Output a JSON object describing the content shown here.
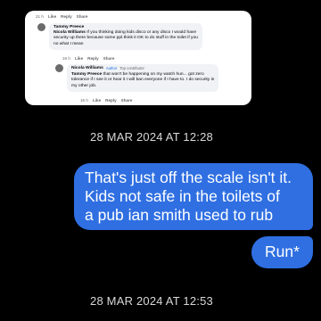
{
  "shared_image": {
    "top_actions": {
      "time": "21 h",
      "like": "Like",
      "reply": "Reply",
      "share": "Share"
    },
    "comment_1": {
      "author": "Tammy Preece",
      "mention": "Nicola Williams",
      "text_1": " If you thinking doing kids disco or any disco I would have",
      "text_2": "security up there because some ppl.think it OK to do stuff in the toilet if you",
      "text_3": "no what I mean"
    },
    "comment_1_actions": {
      "time": "16 h",
      "like": "Like",
      "reply": "Reply",
      "share": "Share"
    },
    "comment_2": {
      "author": "Nicola Williams",
      "badge_author": "Author",
      "badge_role": "Top contributor",
      "mention": "Tammy Preece",
      "text_1": " that won't be happening on my watch hun... got zero",
      "text_2": "tolerance if I see it or hear it I will ban everyone if I have to. I do security in",
      "text_3": "my other job."
    },
    "comment_2_actions": {
      "time": "16 h",
      "like": "Like",
      "reply": "Reply",
      "share": "Share"
    }
  },
  "timestamps": {
    "first": "28 MAR 2024 AT 12:28",
    "second": "28 MAR 2024 AT 12:53"
  },
  "messages": {
    "message_1": {
      "line_1": "That's just off the scale isn't it.",
      "line_2": "Kids not safe in the toilets of",
      "line_3": "a pub ian smith used to rub"
    },
    "message_2": "Run*"
  },
  "colors": {
    "background": "#000000",
    "outgoing_bubble": "#2f6fe2",
    "timestamp_text": "#d8d8d8"
  }
}
